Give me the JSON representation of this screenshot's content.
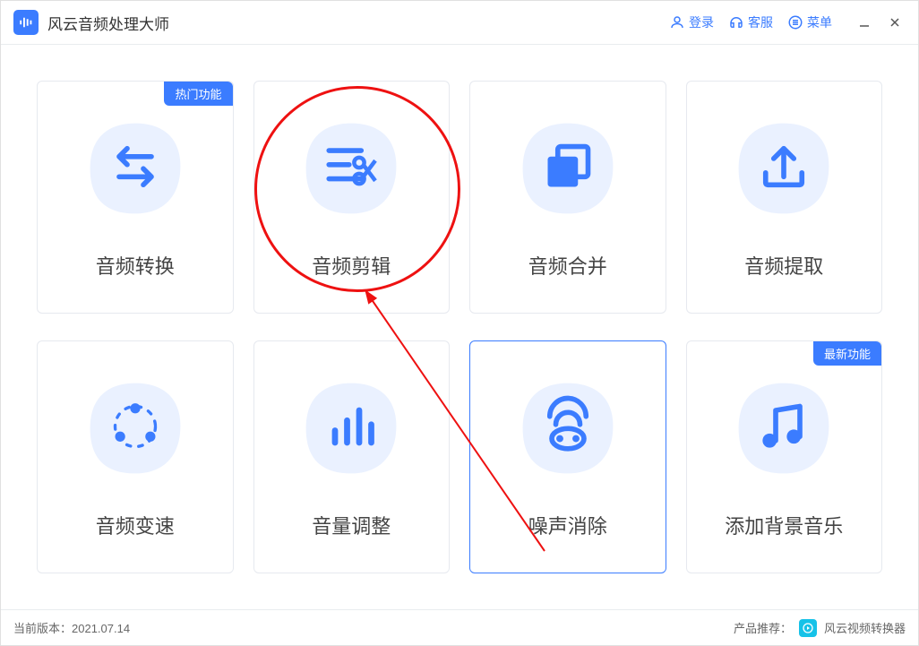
{
  "app": {
    "title": "风云音频处理大师"
  },
  "header": {
    "login": "登录",
    "support": "客服",
    "menu": "菜单"
  },
  "badges": {
    "hot": "热门功能",
    "new": "最新功能"
  },
  "cards": [
    {
      "label": "音频转换"
    },
    {
      "label": "音频剪辑"
    },
    {
      "label": "音频合并"
    },
    {
      "label": "音频提取"
    },
    {
      "label": "音频变速"
    },
    {
      "label": "音量调整"
    },
    {
      "label": "噪声消除"
    },
    {
      "label": "添加背景音乐"
    }
  ],
  "footer": {
    "version_label": "当前版本：",
    "version": "2021.07.14",
    "recommend_label": "产品推荐：",
    "recommend_product": "风云视频转换器"
  }
}
